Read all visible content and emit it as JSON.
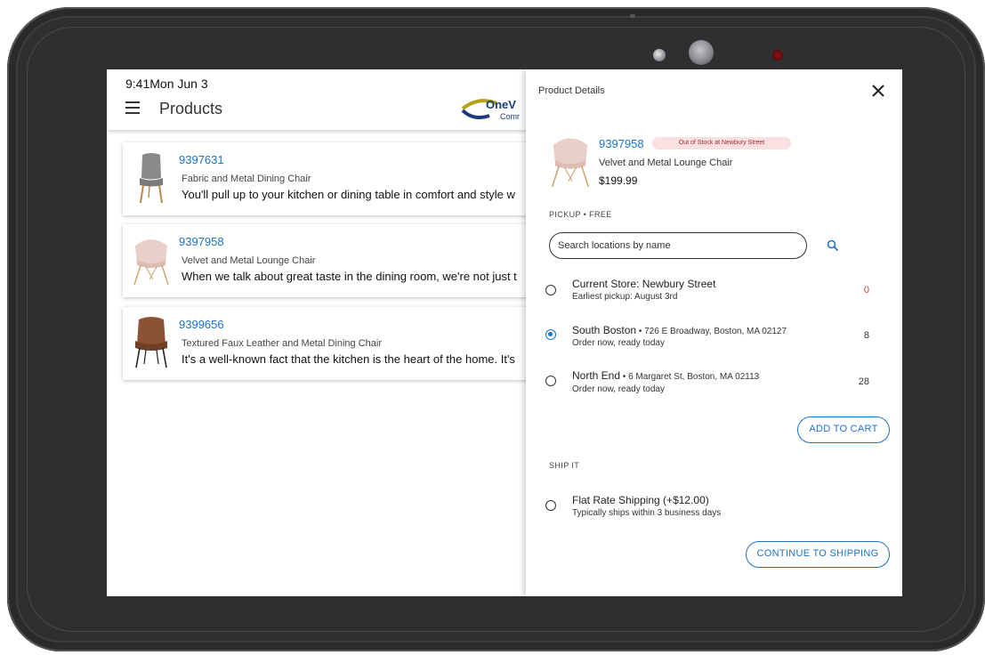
{
  "status": {
    "time": "9:41",
    "date": "Mon Jun 3"
  },
  "app": {
    "title": "Products",
    "logo_text": "OneV",
    "logo_sub": "Comr"
  },
  "products": [
    {
      "sku": "9397631",
      "name": "Fabric and Metal Dining Chair",
      "desc": "You'll pull up to your kitchen or dining table in comfort and style w"
    },
    {
      "sku": "9397958",
      "name": "Velvet and Metal Lounge Chair",
      "desc": "When we talk about great taste in the dining room, we're not just t"
    },
    {
      "sku": "9399656",
      "name": "Textured Faux Leather and Metal Dining Chair",
      "desc": "It's a well-known fact that the kitchen is the heart of the home. It's"
    }
  ],
  "detail": {
    "title": "Product Details",
    "sku": "9397958",
    "stock_badge": "Out of Stock at Newbury Street",
    "name": "Velvet and Metal Lounge Chair",
    "price": "$199.99",
    "pickup_label": "PICKUP • FREE",
    "search_placeholder": "Search locations by name",
    "locations": [
      {
        "name": "Current Store: Newbury Street",
        "address": "",
        "sub": "Earliest pickup: August 3rd",
        "count": "0",
        "selected": false
      },
      {
        "name": "South Boston",
        "address": " • 726 E Broadway, Boston, MA 02127",
        "sub": "Order now, ready today",
        "count": "8",
        "selected": true
      },
      {
        "name": "North End",
        "address": " • 6 Margaret St, Boston, MA 02113",
        "sub": "Order now, ready today",
        "count": "28",
        "selected": false
      }
    ],
    "add_to_cart": "ADD TO CART",
    "ship_label": "SHIP IT",
    "shipping": {
      "name": "Flat Rate Shipping (+$12.00)",
      "sub": "Typically ships within 3 business days"
    },
    "continue": "CONTINUE TO SHIPPING"
  },
  "colors": {
    "accent": "#1a73c9",
    "badge_bg": "#fbe0e2",
    "badge_text": "#a32a31",
    "zero_stock": "#d03a3a"
  }
}
